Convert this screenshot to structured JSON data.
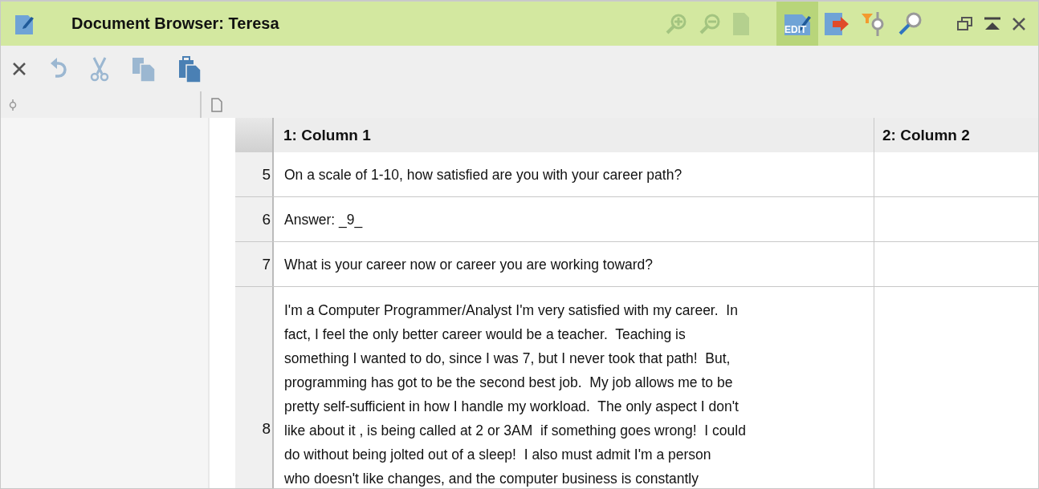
{
  "window": {
    "title": "Document Browser: Teresa"
  },
  "title_tools": [
    {
      "kind": "zoom-in",
      "disabled": true,
      "selected": false
    },
    {
      "kind": "zoom-out",
      "disabled": true,
      "selected": false
    },
    {
      "kind": "zoom-100",
      "disabled": true,
      "selected": false
    },
    {
      "kind": "edit",
      "label": "EDIT",
      "disabled": false,
      "selected": true
    },
    {
      "kind": "export",
      "disabled": false,
      "selected": false
    },
    {
      "kind": "filter",
      "disabled": false,
      "selected": false
    },
    {
      "kind": "search",
      "disabled": false,
      "selected": false
    }
  ],
  "toolbar": [
    {
      "kind": "close",
      "disabled": false
    },
    {
      "kind": "undo",
      "disabled": true
    },
    {
      "kind": "cut",
      "disabled": true
    },
    {
      "kind": "copy",
      "disabled": true
    },
    {
      "kind": "paste",
      "disabled": false
    }
  ],
  "table": {
    "columns": [
      "1: Column 1",
      "2: Column 2"
    ],
    "rows": [
      {
        "number": "5",
        "lines": [
          "On a scale of 1-10, how satisfied are you with your career path?"
        ]
      },
      {
        "number": "6",
        "lines": [
          "Answer: _9_"
        ]
      },
      {
        "number": "7",
        "lines": [
          "What is your career now or career you are working toward?"
        ]
      },
      {
        "number": "8",
        "lines": [
          "I'm a Computer Programmer/Analyst I'm very satisfied with my career.  In",
          "fact, I feel the only better career would be a teacher.  Teaching is",
          "something I wanted to do, since I was 7, but I never took that path!  But,",
          "programming has got to be the second best job.  My job allows me to be",
          "pretty self-sufficient in how I handle my workload.  The only aspect I don't",
          "like about it , is being called at 2 or 3AM  if something goes wrong!  I could",
          "do without being jolted out of a sleep!  I also must admit I'm a person",
          "who doesn't like changes, and the computer business is constantly"
        ]
      }
    ]
  }
}
